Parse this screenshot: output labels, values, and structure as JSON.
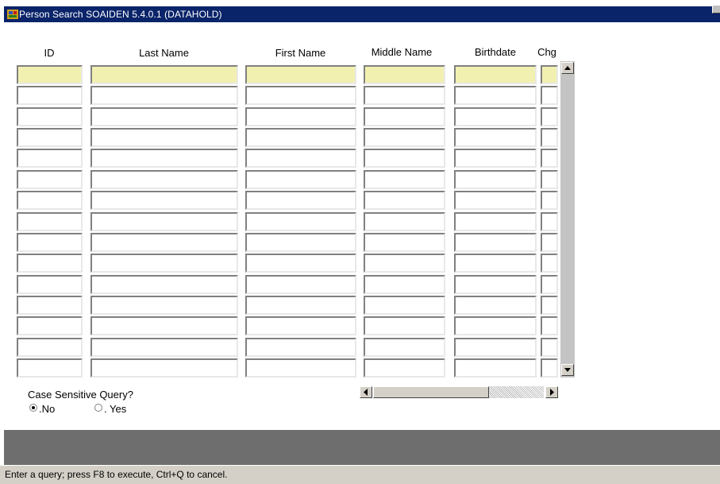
{
  "window": {
    "title": "Person Search  SOAIDEN  5.4.0.1  (DATAHOLD)"
  },
  "grid": {
    "columns": [
      "ID",
      "Last Name",
      "First Name",
      "Middle Name",
      "Birthdate",
      "Chg"
    ],
    "row_count": 15,
    "current_row": 1
  },
  "case_sensitive": {
    "label": "Case Sensitive Query?",
    "options": [
      ".No",
      ". Yes"
    ],
    "selected": ".No"
  },
  "status": {
    "message": "Enter a query;  press F8 to execute, Ctrl+Q to cancel."
  },
  "colors": {
    "title_bar": "#0a246a",
    "current_record": "#f2f0b0",
    "status_bar": "#d4d0c8"
  }
}
